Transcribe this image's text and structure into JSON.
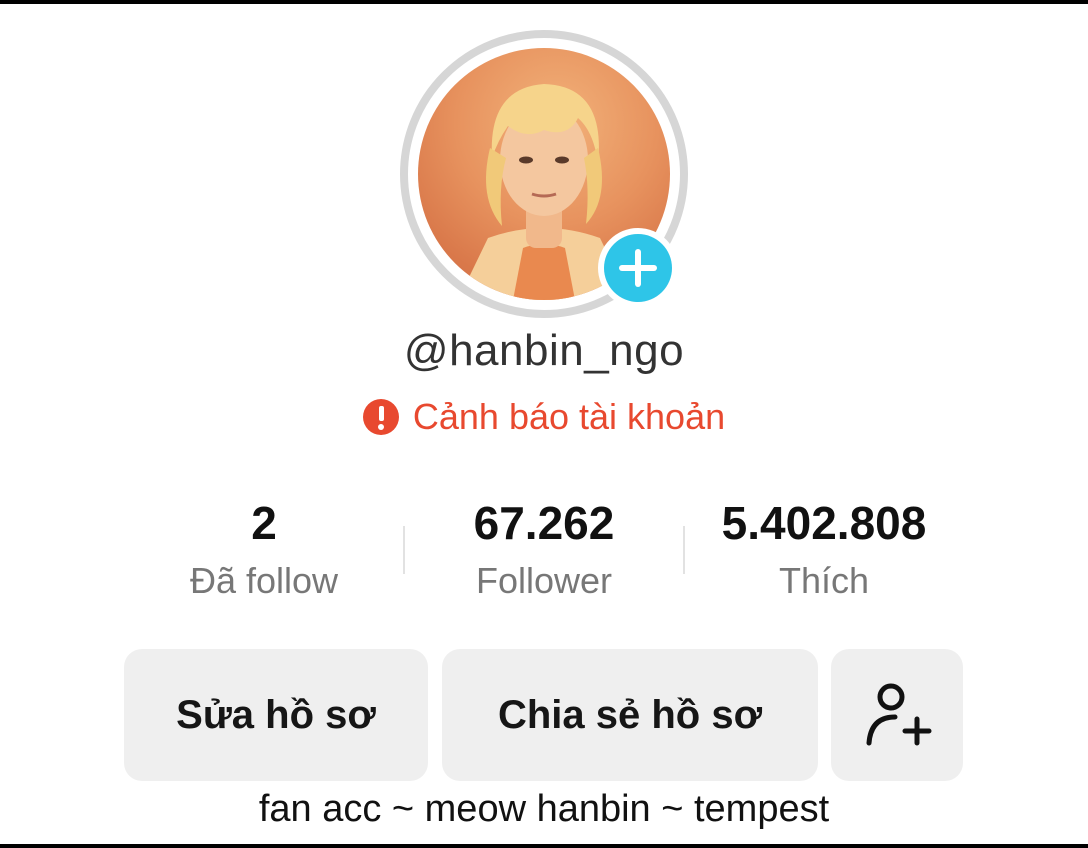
{
  "profile": {
    "username": "@hanbin_ngo",
    "warning_text": "Cảnh báo tài khoản",
    "bio": "fan acc ~ meow hanbin ~ tempest"
  },
  "stats": [
    {
      "value": "2",
      "label": "Đã follow"
    },
    {
      "value": "67.262",
      "label": "Follower"
    },
    {
      "value": "5.402.808",
      "label": "Thích"
    }
  ],
  "actions": {
    "edit_label": "Sửa hồ sơ",
    "share_label": "Chia sẻ hồ sơ",
    "add_friend_icon": "add-user-icon"
  },
  "icons": {
    "avatar_add": "plus-icon",
    "warning": "exclamation-circle-icon"
  },
  "colors": {
    "warning": "#e8492f",
    "add_badge": "#2ec5e8",
    "button_bg": "#efefef"
  }
}
